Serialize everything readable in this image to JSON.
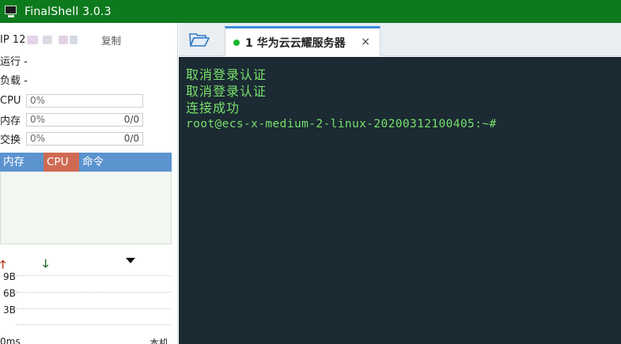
{
  "window": {
    "title": "FinalShell 3.0.3"
  },
  "sidebar": {
    "ip_label": "IP 12",
    "copy_label": "复制",
    "run_label": "运行 -",
    "load_label": "负载 -",
    "cpu": {
      "label": "CPU",
      "value": "0%"
    },
    "memory": {
      "label": "内存",
      "value": "0%",
      "detail": "0/0"
    },
    "swap": {
      "label": "交换",
      "value": "0%",
      "detail": "0/0"
    },
    "process_tabs": [
      "内存",
      "CPU",
      "命令"
    ],
    "network": {
      "y_labels": [
        "9B",
        "6B",
        "3B"
      ],
      "latency_label": "0ms",
      "host_label": "本机"
    }
  },
  "tabs": [
    {
      "index": "1",
      "label": "华为云云耀服务器",
      "status": "connected",
      "close": "×"
    }
  ],
  "terminal": {
    "lines": [
      "取消登录认证",
      "取消登录认证",
      "连接成功",
      "root@ecs-x-medium-2-linux-20200312100405:~#"
    ]
  },
  "colors": {
    "titlebar": "#0e7a1e",
    "terminal_bg": "#1b2a33",
    "terminal_fg": "#78e06a",
    "process_header": "#5b93cf",
    "cpu_tab": "#cf6a52",
    "tab_accent": "#3d8fd6",
    "status_dot": "#1bb92a"
  },
  "icons": {
    "app": "terminal-monitor-icon",
    "folder": "folder-open-icon",
    "upload": "arrow-up-icon",
    "download": "arrow-down-icon",
    "dropdown": "triangle-down-icon",
    "close": "close-icon"
  }
}
